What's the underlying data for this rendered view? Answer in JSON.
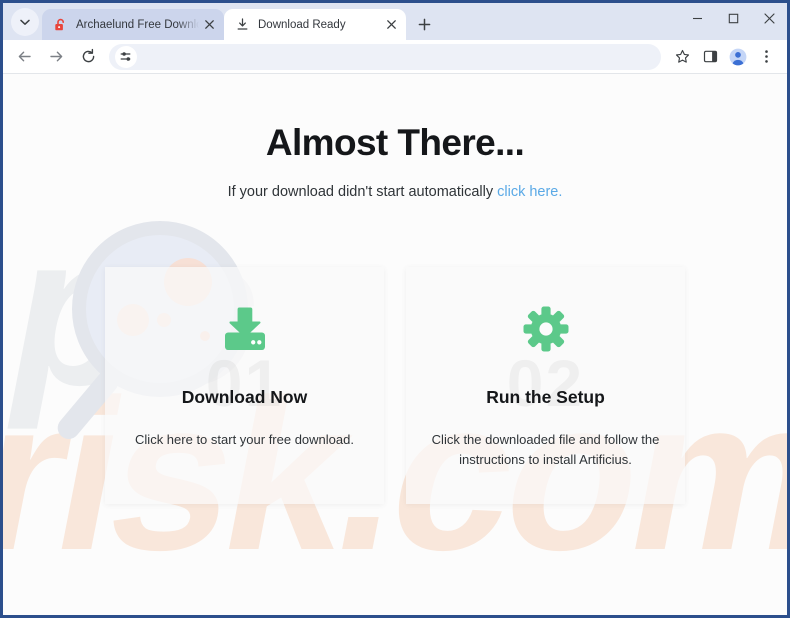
{
  "browser": {
    "tab_search_icon": "chevron-down-icon",
    "tabs": [
      {
        "title": "Archaelund Free Download » ST",
        "favicon": "unlocked-padlock-icon",
        "active": false,
        "close_icon": "close-icon"
      },
      {
        "title": "Download Ready",
        "favicon": "download-icon",
        "active": true,
        "close_icon": "close-icon"
      }
    ],
    "new_tab_icon": "plus-icon",
    "window_controls": {
      "minimize": "minimize-icon",
      "maximize": "maximize-icon",
      "close": "close-icon"
    },
    "toolbar": {
      "back_icon": "arrow-left-icon",
      "forward_icon": "arrow-right-icon",
      "reload_icon": "reload-icon",
      "omnibox_icon": "tune-sliders-icon",
      "omnibox_value": "",
      "omnibox_placeholder": "",
      "bookmark_icon": "star-icon",
      "side_panel_icon": "side-panel-icon",
      "profile_icon": "profile-avatar-icon",
      "menu_icon": "three-dot-menu-icon"
    }
  },
  "page": {
    "title": "Almost There...",
    "subtitle_prefix": "If your download didn't start automatically ",
    "subtitle_link": "click here.",
    "cards": [
      {
        "number": "01",
        "icon": "download-tray-icon",
        "title": "Download Now",
        "description": "Click here to start your free download."
      },
      {
        "number": "02",
        "icon": "gear-icon",
        "title": "Run the Setup",
        "description": "Click the downloaded file and follow the instructions to install Artificius."
      }
    ],
    "watermark": {
      "text": "pcrisk.com",
      "magnifier_icon": "magnifying-glass-watermark-icon"
    }
  },
  "colors": {
    "accent_green": "#5cc98a",
    "link_blue": "#5aa9e6",
    "browser_frame": "#2c4f8c",
    "tab_strip": "#dee4f2",
    "inactive_tab": "#ccd5ec",
    "watermark_peach": "#f7e3d8"
  }
}
